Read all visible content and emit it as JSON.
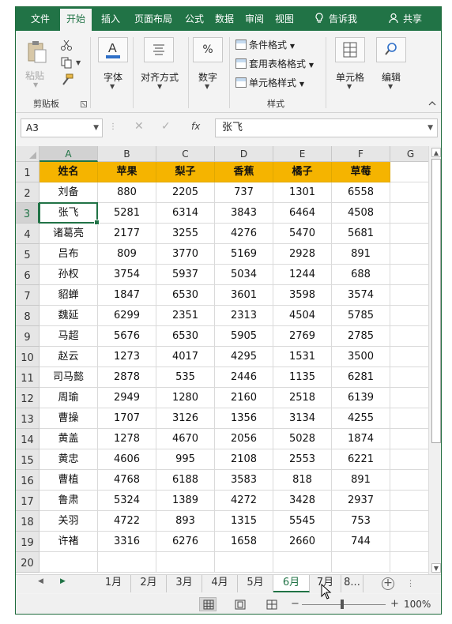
{
  "ribbon": {
    "tabs": [
      "文件",
      "开始",
      "插入",
      "页面布局",
      "公式",
      "数据",
      "审阅",
      "视图"
    ],
    "active_tab": "开始",
    "tell_me": "告诉我",
    "share": "共享",
    "groups": {
      "clipboard": {
        "paste": "粘贴",
        "label": "剪贴板"
      },
      "font": {
        "label": "字体"
      },
      "alignment": {
        "label": "对齐方式"
      },
      "number": {
        "label": "数字",
        "icon_text": "%"
      },
      "styles": {
        "conditional_format": "条件格式",
        "format_as_table": "套用表格格式",
        "cell_styles": "单元格样式",
        "label": "样式"
      },
      "cells": {
        "label": "单元格"
      },
      "editing": {
        "label": "编辑"
      }
    }
  },
  "formula_bar": {
    "name_box": "A3",
    "content": "张飞",
    "fx": "fx"
  },
  "grid": {
    "columns": [
      "A",
      "B",
      "C",
      "D",
      "E",
      "F",
      "G"
    ],
    "selected_column": "A",
    "rows": [
      "1",
      "2",
      "3",
      "4",
      "5",
      "6",
      "7",
      "8",
      "9",
      "10",
      "11",
      "12",
      "13",
      "14",
      "15",
      "16",
      "17",
      "18",
      "19",
      "20"
    ],
    "selected_row": "3",
    "header_fill": "#f5b400",
    "header": [
      "姓名",
      "苹果",
      "梨子",
      "香蕉",
      "橘子",
      "草莓"
    ],
    "data": [
      [
        "刘备",
        "880",
        "2205",
        "737",
        "1301",
        "6558"
      ],
      [
        "张飞",
        "5281",
        "6314",
        "3843",
        "6464",
        "4508"
      ],
      [
        "诸葛亮",
        "2177",
        "3255",
        "4276",
        "5470",
        "5681"
      ],
      [
        "吕布",
        "809",
        "3770",
        "5169",
        "2928",
        "891"
      ],
      [
        "孙权",
        "3754",
        "5937",
        "5034",
        "1244",
        "688"
      ],
      [
        "貂蝉",
        "1847",
        "6530",
        "3601",
        "3598",
        "3574"
      ],
      [
        "魏延",
        "6299",
        "2351",
        "2313",
        "4504",
        "5785"
      ],
      [
        "马超",
        "5676",
        "6530",
        "5905",
        "2769",
        "2785"
      ],
      [
        "赵云",
        "1273",
        "4017",
        "4295",
        "1531",
        "3500"
      ],
      [
        "司马懿",
        "2878",
        "535",
        "2446",
        "1135",
        "6281"
      ],
      [
        "周瑜",
        "2949",
        "1280",
        "2160",
        "2518",
        "6139"
      ],
      [
        "曹操",
        "1707",
        "3126",
        "1356",
        "3134",
        "4255"
      ],
      [
        "黄盖",
        "1278",
        "4670",
        "2056",
        "5028",
        "1874"
      ],
      [
        "黄忠",
        "4606",
        "995",
        "2108",
        "2553",
        "6221"
      ],
      [
        "曹植",
        "4768",
        "6188",
        "3583",
        "818",
        "891"
      ],
      [
        "鲁肃",
        "5324",
        "1389",
        "4272",
        "3428",
        "2937"
      ],
      [
        "关羽",
        "4722",
        "893",
        "1315",
        "5545",
        "753"
      ],
      [
        "许褚",
        "3316",
        "6276",
        "1658",
        "2660",
        "744"
      ]
    ]
  },
  "sheets": {
    "tabs": [
      "1月",
      "2月",
      "3月",
      "4月",
      "5月",
      "6月",
      "7月",
      "8..."
    ],
    "active": "6月"
  },
  "status": {
    "zoom": "100%",
    "zoom_minus": "−",
    "zoom_plus": "+"
  },
  "colors": {
    "accent": "#217346",
    "header_fill": "#f5b400"
  }
}
